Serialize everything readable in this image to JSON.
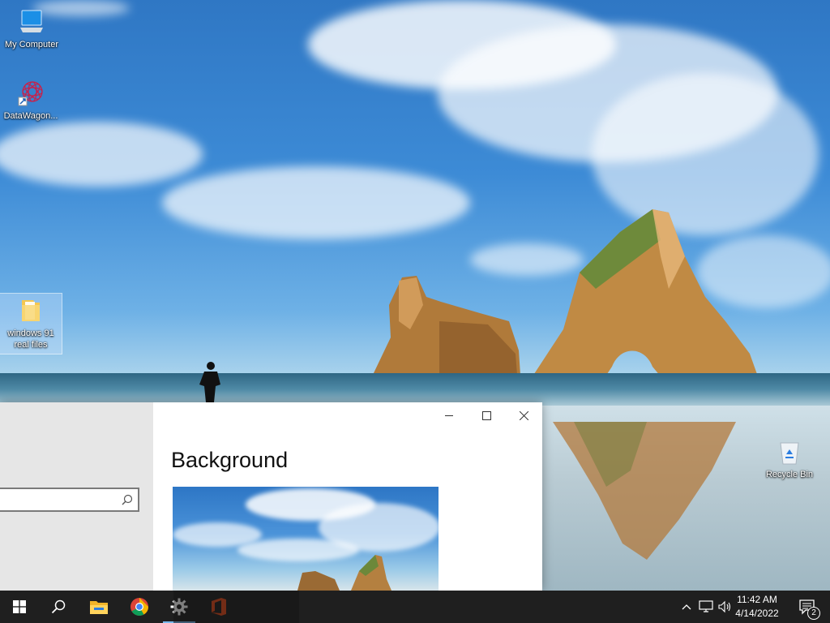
{
  "desktop": {
    "icons": [
      {
        "label": "My Computer",
        "icon": "computer-icon"
      },
      {
        "label": "DataWagon...",
        "icon": "datawagon-icon"
      },
      {
        "label": "windows 91 real files",
        "icon": "folder-icon"
      },
      {
        "label": "Recycle Bin",
        "icon": "recycle-bin-icon"
      }
    ]
  },
  "settings": {
    "heading": "Background",
    "search_placeholder": "",
    "controls": {
      "minimize": "—",
      "maximize": "☐",
      "close": "✕"
    }
  },
  "taskbar": {
    "apps": [
      {
        "name": "start",
        "icon": "windows-logo-icon"
      },
      {
        "name": "search",
        "icon": "search-icon"
      },
      {
        "name": "file-explorer",
        "icon": "folder-icon"
      },
      {
        "name": "chrome",
        "icon": "chrome-icon"
      },
      {
        "name": "settings",
        "icon": "gear-icon"
      },
      {
        "name": "office",
        "icon": "office-icon"
      }
    ],
    "tray": {
      "chevron": "^",
      "time": "11:42 AM",
      "date": "4/14/2022",
      "notification_count": "2"
    }
  },
  "colors": {
    "taskbar_bg": "#1f1f1f",
    "accent": "#76b9ed",
    "settings_left_pane": "#e6e6e6"
  }
}
